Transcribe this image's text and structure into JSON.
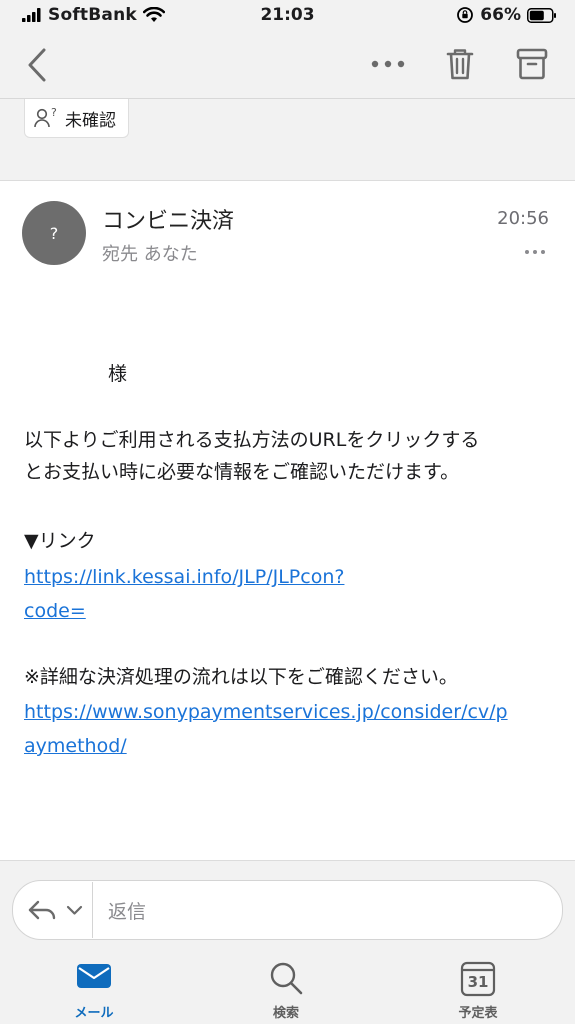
{
  "status_bar": {
    "carrier": "SoftBank",
    "time": "21:03",
    "battery": "66%"
  },
  "toolbar": {
    "back_icon": "chevron-left-icon",
    "more_icon": "ellipsis-icon",
    "delete_icon": "trash-icon",
    "archive_icon": "archive-icon"
  },
  "tag": {
    "label": "未確認"
  },
  "message": {
    "avatar_char": "?",
    "sender": "コンビニ決済",
    "recipient": "宛先 あなた",
    "time": "20:56",
    "body": {
      "greeting": "様",
      "paragraph_line1": "以下よりご利用される支払方法のURLをクリックする",
      "paragraph_line2": "とお支払い時に必要な情報をご確認いただけます。",
      "link_heading": "▼リンク",
      "link1_line1": "https://link.kessai.info/JLP/JLPcon?",
      "link1_line2": "code=",
      "detail_text": "※詳細な決済処理の流れは以下をご確認ください。",
      "link2_line1": "https://www.sonypaymentservices.jp/consider/cv/p",
      "link2_line2": "aymethod/"
    }
  },
  "reply": {
    "placeholder": "返信"
  },
  "tabs": [
    {
      "label": "メール",
      "icon": "mail-icon",
      "active": true
    },
    {
      "label": "検索",
      "icon": "search-icon",
      "active": false
    },
    {
      "label": "予定表",
      "icon": "calendar-icon",
      "active": false,
      "badge": "31"
    }
  ],
  "colors": {
    "accent": "#1a73d8",
    "tab_active": "#0f6cbd"
  }
}
